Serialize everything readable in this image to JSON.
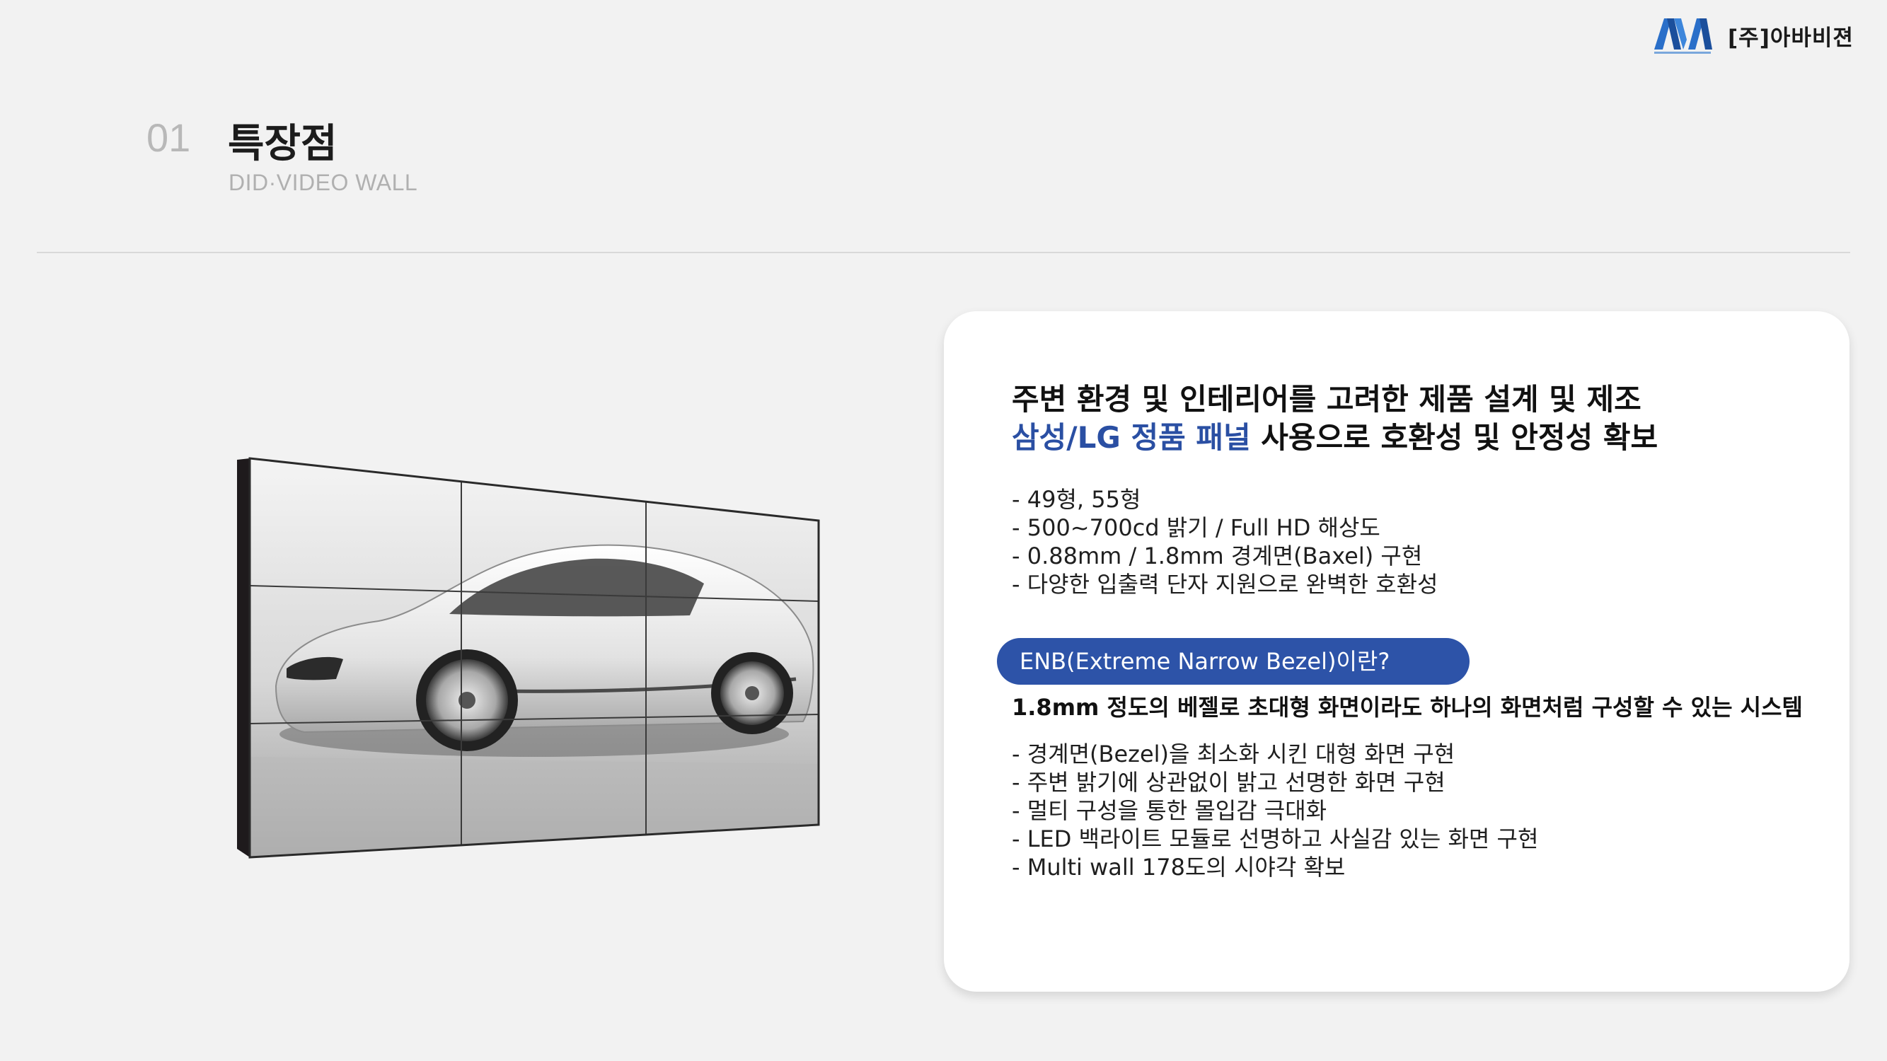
{
  "logo": {
    "company": "[주]아바비젼",
    "icon": "ava-logo-icon",
    "brand_color": "#2a6fc9"
  },
  "header": {
    "number": "01",
    "title": "특장점",
    "subtitle": "DID·VIDEO WALL"
  },
  "card": {
    "headline_line1": "주변 환경 및 인테리어를 고려한 제품 설계 및 제조",
    "headline_accent": "삼성/LG 정품 패널",
    "headline_rest": " 사용으로 호환성 및 안정성 확보",
    "specs": [
      "- 49형, 55형",
      "- 500~700cd 밝기 / Full HD 해상도",
      "- 0.88mm / 1.8mm 경계면(Baxel) 구현",
      "- 다양한 입출력 단자 지원으로 완벽한 호환성"
    ],
    "pill_label": "ENB(Extreme Narrow Bezel)이란?",
    "pill_desc": "1.8mm 정도의 베젤로 초대형 화면이라도 하나의 화면처럼 구성할 수 있는 시스템",
    "features": [
      "- 경계면(Bezel)을 최소화 시킨 대형 화면 구현",
      "- 주변 밝기에 상관없이 밝고 선명한 화면 구현",
      "- 멀티 구성을 통한 몰입감 극대화",
      "- LED 백라이트 모듈로 선명하고 사실감 있는 화면 구현",
      "- Multi wall 178도의 시야각 확보"
    ]
  },
  "colors": {
    "accent": "#2a4fa3",
    "pill": "#2d53a8",
    "background": "#f2f2f2"
  }
}
